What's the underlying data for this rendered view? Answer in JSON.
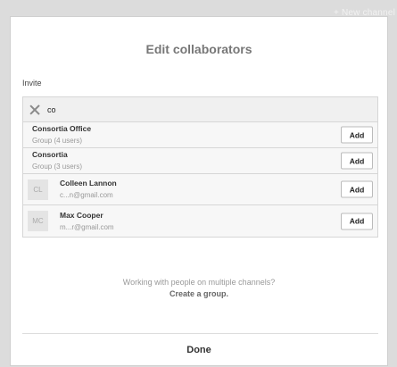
{
  "background": {
    "new_channel_label": "+ New channel"
  },
  "modal": {
    "title": "Edit collaborators",
    "invite_label": "Invite",
    "search": {
      "value": "co",
      "placeholder": ""
    },
    "results": [
      {
        "type": "group",
        "name": "Consortia Office",
        "detail": "Group (4 users)",
        "action": "Add"
      },
      {
        "type": "group",
        "name": "Consortia",
        "detail": "Group (3 users)",
        "action": "Add"
      },
      {
        "type": "user",
        "initials": "CL",
        "name": "Colleen Lannon",
        "detail": "c...n@gmail.com",
        "action": "Add"
      },
      {
        "type": "user",
        "initials": "MC",
        "name": "Max Cooper",
        "detail": "m...r@gmail.com",
        "action": "Add"
      }
    ],
    "hint_text": "Working with people on multiple channels?",
    "hint_link": "Create a group.",
    "done_label": "Done"
  }
}
